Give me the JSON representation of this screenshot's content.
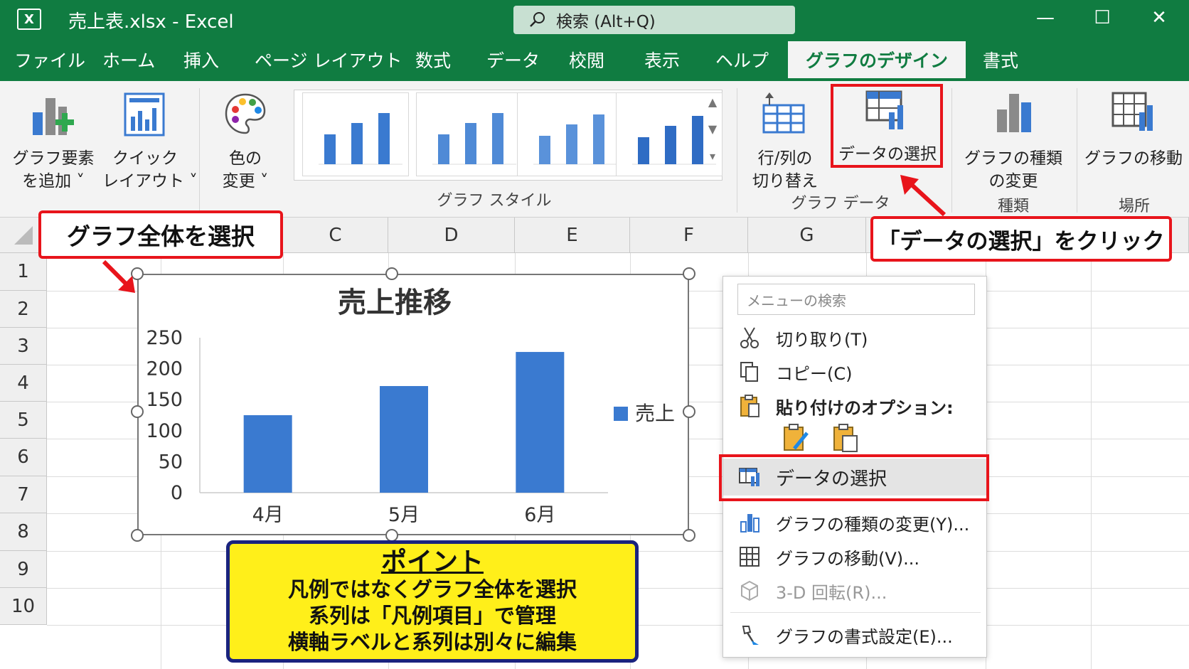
{
  "window": {
    "app_icon": "X",
    "title": "売上表.xlsx  -  Excel",
    "search_placeholder": "検索 (Alt+Q)",
    "controls": {
      "minimize": "—",
      "maximize": "☐",
      "close": "✕"
    }
  },
  "tabs": [
    "ファイル",
    "ホーム",
    "挿入",
    "ページ レイアウト",
    "数式",
    "データ",
    "校閲",
    "表示",
    "ヘルプ"
  ],
  "active_tab": "グラフのデザイン",
  "tab_after": "書式",
  "ribbon": {
    "add_element": [
      "グラフ要素",
      "を追加 ˅"
    ],
    "quick_layout": [
      "クイック",
      "レイアウト ˅"
    ],
    "change_color": [
      "色の",
      "変更 ˅"
    ],
    "styles_group": "グラフ スタイル",
    "switch_rowcol": [
      "行/列の",
      "切り替え"
    ],
    "select_data": "データの選択",
    "data_group": "グラフ データ",
    "change_type": [
      "グラフの種類",
      "の変更"
    ],
    "type_group": "種類",
    "move_chart": "グラフの移動",
    "location_group": "場所"
  },
  "sheet": {
    "columns": [
      "C",
      "D",
      "E",
      "F",
      "G"
    ],
    "rows": [
      "1",
      "2",
      "3",
      "4",
      "5",
      "6",
      "7",
      "8",
      "9",
      "10"
    ]
  },
  "chart_data": {
    "type": "bar",
    "title": "売上推移",
    "categories": [
      "4月",
      "5月",
      "6月"
    ],
    "series": [
      {
        "name": "売上",
        "values": [
          125,
          172,
          227
        ]
      }
    ],
    "ylim": [
      0,
      250
    ],
    "yticks": [
      "250",
      "200",
      "150",
      "100",
      "50",
      "0"
    ],
    "grid": false,
    "legend": "right",
    "bar_color": "#3a7ad0"
  },
  "callouts": {
    "select_chart": "グラフ全体を選択",
    "click_select_data": "「データの選択」をクリック"
  },
  "point": {
    "title": "ポイント",
    "lines": [
      "凡例ではなくグラフ全体を選択",
      "系列は「凡例項目」で管理",
      "横軸ラベルと系列は別々に編集"
    ]
  },
  "context_menu": {
    "search_placeholder": "メニューの検索",
    "cut": "切り取り(T)",
    "copy": "コピー(C)",
    "paste_options": "貼り付けのオプション:",
    "select_data": "データの選択",
    "change_type": "グラフの種類の変更(Y)...",
    "move_chart": "グラフの移動(V)...",
    "rotate_3d": "3-D 回転(R)...",
    "format_chart": "グラフの書式設定(E)..."
  },
  "colors": {
    "excel_green": "#107c41",
    "callout_red": "#e8141b",
    "point_yellow": "#ffef1a",
    "point_border": "#1a237e"
  }
}
